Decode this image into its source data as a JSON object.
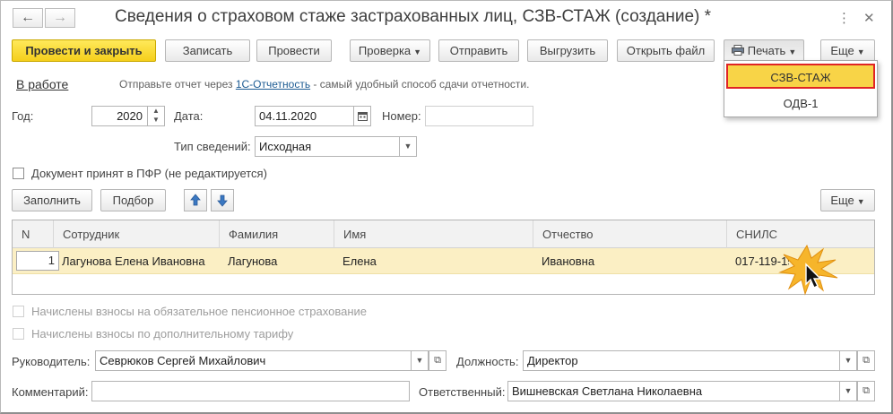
{
  "window": {
    "title": "Сведения о страховом стаже застрахованных лиц, СЗВ-СТАЖ (создание) *",
    "back_icon": "arrow-left-icon",
    "forward_icon": "arrow-right-icon",
    "more_icon": "vertical-dots-icon",
    "close_icon": "close-icon"
  },
  "toolbar": {
    "post_close": "Провести и закрыть",
    "save": "Записать",
    "post": "Провести",
    "check": "Проверка",
    "send": "Отправить",
    "export": "Выгрузить",
    "open_file": "Открыть файл",
    "print": "Печать",
    "more": "Еще"
  },
  "print_menu": {
    "items": [
      "СЗВ-СТАЖ",
      "ОДВ-1"
    ],
    "selected": "СЗВ-СТАЖ"
  },
  "status_bar": {
    "status": "В работе",
    "hint_before": "Отправьте отчет через ",
    "hint_link": "1С-Отчетность",
    "hint_after": " - самый удобный способ сдачи отчетности."
  },
  "form": {
    "year_label": "Год:",
    "year_value": "2020",
    "date_label": "Дата:",
    "date_value": "04.11.2020",
    "number_label": "Номер:",
    "number_value": "",
    "type_label": "Тип сведений:",
    "type_value": "Исходная",
    "accepted_label": "Документ принят в ПФР (не редактируется)",
    "accepted_checked": false
  },
  "table_toolbar": {
    "fill": "Заполнить",
    "select": "Подбор",
    "up_icon": "arrow-up-icon",
    "down_icon": "arrow-down-icon",
    "more": "Еще"
  },
  "table": {
    "columns": [
      "N",
      "Сотрудник",
      "Фамилия",
      "Имя",
      "Отчество",
      "СНИЛС"
    ],
    "rows": [
      [
        "1",
        "Лагунова Елена Ивановна",
        "Лагунова",
        "Елена",
        "Ивановна",
        "017-119-19"
      ]
    ]
  },
  "flags": {
    "pension_label": "Начислены взносы на обязательное пенсионное страхование",
    "additional_label": "Начислены взносы по дополнительному тарифу"
  },
  "footer": {
    "head_label": "Руководитель:",
    "head_value": "Севрюков Сергей Михайлович",
    "position_label": "Должность:",
    "position_value": "Директор",
    "comment_label": "Комментарий:",
    "comment_value": "",
    "responsible_label": "Ответственный:",
    "responsible_value": "Вишневская Светлана Николаевна"
  },
  "colors": {
    "primary_button": "#f5cf1b",
    "selected_row": "#fbefc4",
    "menu_highlight": "#f8d447",
    "menu_outline": "#e02424",
    "link": "#1c5b93"
  }
}
